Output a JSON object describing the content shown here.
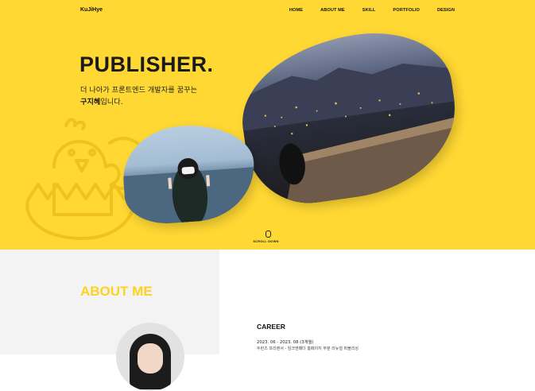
{
  "nav": {
    "logo": "KuJiHye",
    "items": [
      "HOME",
      "ABOUT ME",
      "SKILL",
      "PORTFOLIO",
      "DESIGN"
    ]
  },
  "hero": {
    "title": "PUBLISHER.",
    "intro_line1": "더 나아가 프론트엔드 개발자를 꿈꾸는",
    "intro_name": "구지혜",
    "intro_suffix": "입니다.",
    "scroll_label": "SCROLL DOWN"
  },
  "about": {
    "title": "ABOUT ME",
    "career_title": "CAREER",
    "career_date": "2023. 06 - 2023. 08 (3개월)",
    "career_desc": "두런즈 프리랜서 - 임크앤페더 홈페이지 부분 리뉴얼 퍼블리싱"
  },
  "colors": {
    "accent": "#FFD833",
    "title_yellow": "#FFD21F"
  }
}
